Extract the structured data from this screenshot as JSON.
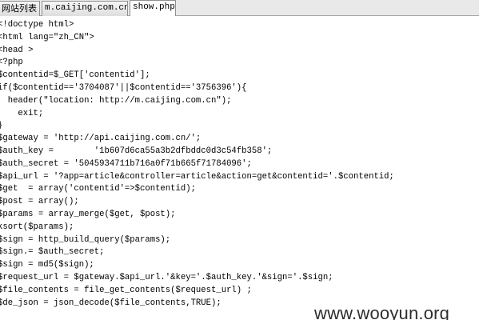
{
  "tabs": [
    {
      "label": "网站列表",
      "active": false
    },
    {
      "label": "m.caijing.com.cn",
      "active": false
    },
    {
      "label": "show.php",
      "active": true
    }
  ],
  "code_lines": [
    "<!doctype html>",
    "<html lang=\"zh_CN\">",
    "<head >",
    "<?php",
    "$contentid=$_GET['contentid'];",
    "if($contentid=='3704087'||$contentid=='3756396'){",
    "  header(\"location: http://m.caijing.com.cn\");",
    "    exit;",
    "}",
    "$gateway = 'http://api.caijing.com.cn/';",
    "$auth_key =        '1b607d6ca55a3b2dfbddc0d3c54fb358';",
    "$auth_secret = '5045934711b716a0f71b665f71784096';",
    "$api_url = '?app=article&controller=article&action=get&contentid='.$contentid;",
    "$get  = array('contentid'=>$contentid);",
    "$post = array();",
    "$params = array_merge($get, $post);",
    "ksort($params);",
    "$sign = http_build_query($params);",
    "$sign.= $auth_secret;",
    "$sign = md5($sign);",
    "$request_url = $gateway.$api_url.'&key='.$auth_key.'&sign='.$sign;",
    "$file_contents = file_get_contents($request_url) ;",
    "$de_json = json_decode($file_contents,TRUE);"
  ],
  "watermark": "www.wooyun.org"
}
